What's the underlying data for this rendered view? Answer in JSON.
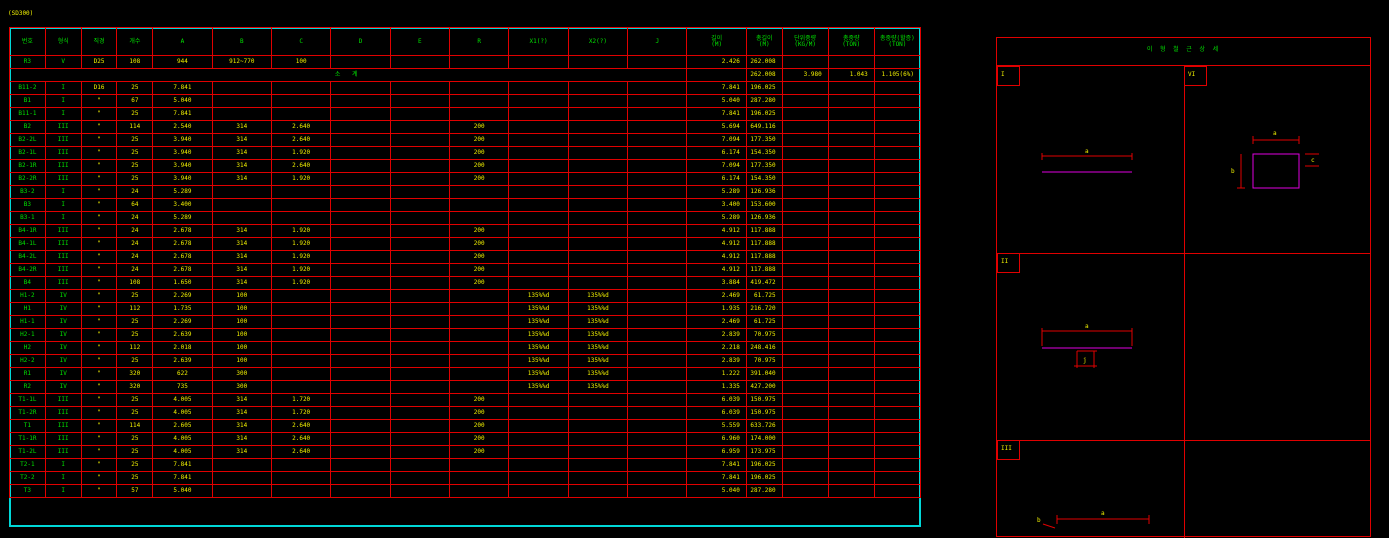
{
  "caption": "(SD300)",
  "table": {
    "headers": [
      "번호",
      "형식",
      "직경",
      "개수",
      "A",
      "B",
      "C",
      "D",
      "E",
      "R",
      "X1(?)",
      "X2(?)",
      "J",
      [
        "길이",
        "(M)"
      ],
      [
        "총길이",
        "(M)"
      ],
      [
        "단위중량",
        "(KG/M)"
      ],
      [
        "총중량",
        "(TON)"
      ],
      [
        "총중량(할증)",
        "(TON)"
      ]
    ],
    "rows": [
      [
        "R3",
        "V",
        "D25",
        "108",
        "944",
        "912~770",
        "100",
        "",
        "",
        "",
        "",
        "",
        "",
        "2.426",
        "262.008",
        "",
        "",
        ""
      ],
      [
        "B11-2",
        "I",
        "D16",
        "25",
        "7.841",
        "",
        "",
        "",
        "",
        "",
        "",
        "",
        "",
        "7.841",
        "196.025",
        "",
        "",
        ""
      ],
      [
        "B1",
        "I",
        "\"",
        "67",
        "5.040",
        "",
        "",
        "",
        "",
        "",
        "",
        "",
        "",
        "5.040",
        "287.280",
        "",
        "",
        ""
      ],
      [
        "B11-1",
        "I",
        "\"",
        "25",
        "7.841",
        "",
        "",
        "",
        "",
        "",
        "",
        "",
        "",
        "7.841",
        "196.025",
        "",
        "",
        ""
      ],
      [
        "B2",
        "III",
        "\"",
        "114",
        "2.540",
        "314",
        "2.640",
        "",
        "",
        "200",
        "",
        "",
        "",
        "5.694",
        "649.116",
        "",
        "",
        ""
      ],
      [
        "B2-2L",
        "III",
        "\"",
        "25",
        "3.940",
        "314",
        "2.640",
        "",
        "",
        "200",
        "",
        "",
        "",
        "7.094",
        "177.350",
        "",
        "",
        ""
      ],
      [
        "B2-1L",
        "III",
        "\"",
        "25",
        "3.940",
        "314",
        "1.920",
        "",
        "",
        "200",
        "",
        "",
        "",
        "6.174",
        "154.350",
        "",
        "",
        ""
      ],
      [
        "B2-1R",
        "III",
        "\"",
        "25",
        "3.940",
        "314",
        "2.640",
        "",
        "",
        "200",
        "",
        "",
        "",
        "7.094",
        "177.350",
        "",
        "",
        ""
      ],
      [
        "B2-2R",
        "III",
        "\"",
        "25",
        "3.940",
        "314",
        "1.920",
        "",
        "",
        "200",
        "",
        "",
        "",
        "6.174",
        "154.350",
        "",
        "",
        ""
      ],
      [
        "B3-2",
        "I",
        "\"",
        "24",
        "5.289",
        "",
        "",
        "",
        "",
        "",
        "",
        "",
        "",
        "5.289",
        "126.936",
        "",
        "",
        ""
      ],
      [
        "B3",
        "I",
        "\"",
        "64",
        "3.400",
        "",
        "",
        "",
        "",
        "",
        "",
        "",
        "",
        "3.400",
        "153.600",
        "",
        "",
        ""
      ],
      [
        "B3-1",
        "I",
        "\"",
        "24",
        "5.289",
        "",
        "",
        "",
        "",
        "",
        "",
        "",
        "",
        "5.289",
        "126.936",
        "",
        "",
        ""
      ],
      [
        "B4-1R",
        "III",
        "\"",
        "24",
        "2.678",
        "314",
        "1.920",
        "",
        "",
        "200",
        "",
        "",
        "",
        "4.912",
        "117.888",
        "",
        "",
        ""
      ],
      [
        "B4-1L",
        "III",
        "\"",
        "24",
        "2.678",
        "314",
        "1.920",
        "",
        "",
        "200",
        "",
        "",
        "",
        "4.912",
        "117.888",
        "",
        "",
        ""
      ],
      [
        "B4-2L",
        "III",
        "\"",
        "24",
        "2.678",
        "314",
        "1.920",
        "",
        "",
        "200",
        "",
        "",
        "",
        "4.912",
        "117.888",
        "",
        "",
        ""
      ],
      [
        "B4-2R",
        "III",
        "\"",
        "24",
        "2.678",
        "314",
        "1.920",
        "",
        "",
        "200",
        "",
        "",
        "",
        "4.912",
        "117.888",
        "",
        "",
        ""
      ],
      [
        "B4",
        "III",
        "\"",
        "108",
        "1.650",
        "314",
        "1.920",
        "",
        "",
        "200",
        "",
        "",
        "",
        "3.884",
        "419.472",
        "",
        "",
        ""
      ],
      [
        "H1-2",
        "IV",
        "\"",
        "25",
        "2.269",
        "100",
        "",
        "",
        "",
        "",
        "135%%d",
        "135%%d",
        "",
        "2.469",
        "61.725",
        "",
        "",
        ""
      ],
      [
        "H1",
        "IV",
        "\"",
        "112",
        "1.735",
        "100",
        "",
        "",
        "",
        "",
        "135%%d",
        "135%%d",
        "",
        "1.935",
        "216.720",
        "",
        "",
        ""
      ],
      [
        "H1-1",
        "IV",
        "\"",
        "25",
        "2.269",
        "100",
        "",
        "",
        "",
        "",
        "135%%d",
        "135%%d",
        "",
        "2.469",
        "61.725",
        "",
        "",
        ""
      ],
      [
        "H2-1",
        "IV",
        "\"",
        "25",
        "2.639",
        "100",
        "",
        "",
        "",
        "",
        "135%%d",
        "135%%d",
        "",
        "2.839",
        "70.975",
        "",
        "",
        ""
      ],
      [
        "H2",
        "IV",
        "\"",
        "112",
        "2.018",
        "100",
        "",
        "",
        "",
        "",
        "135%%d",
        "135%%d",
        "",
        "2.218",
        "248.416",
        "",
        "",
        ""
      ],
      [
        "H2-2",
        "IV",
        "\"",
        "25",
        "2.639",
        "100",
        "",
        "",
        "",
        "",
        "135%%d",
        "135%%d",
        "",
        "2.839",
        "70.975",
        "",
        "",
        ""
      ],
      [
        "R1",
        "IV",
        "\"",
        "320",
        "622",
        "300",
        "",
        "",
        "",
        "",
        "135%%d",
        "135%%d",
        "",
        "1.222",
        "391.040",
        "",
        "",
        ""
      ],
      [
        "R2",
        "IV",
        "\"",
        "320",
        "735",
        "300",
        "",
        "",
        "",
        "",
        "135%%d",
        "135%%d",
        "",
        "1.335",
        "427.200",
        "",
        "",
        ""
      ],
      [
        "T1-1L",
        "III",
        "\"",
        "25",
        "4.005",
        "314",
        "1.720",
        "",
        "",
        "200",
        "",
        "",
        "",
        "6.039",
        "150.975",
        "",
        "",
        ""
      ],
      [
        "T1-2R",
        "III",
        "\"",
        "25",
        "4.005",
        "314",
        "1.720",
        "",
        "",
        "200",
        "",
        "",
        "",
        "6.039",
        "150.975",
        "",
        "",
        ""
      ],
      [
        "T1",
        "III",
        "\"",
        "114",
        "2.605",
        "314",
        "2.640",
        "",
        "",
        "200",
        "",
        "",
        "",
        "5.559",
        "633.726",
        "",
        "",
        ""
      ],
      [
        "T1-1R",
        "III",
        "\"",
        "25",
        "4.005",
        "314",
        "2.640",
        "",
        "",
        "200",
        "",
        "",
        "",
        "6.960",
        "174.000",
        "",
        "",
        ""
      ],
      [
        "T1-2L",
        "III",
        "\"",
        "25",
        "4.005",
        "314",
        "2.640",
        "",
        "",
        "200",
        "",
        "",
        "",
        "6.959",
        "173.975",
        "",
        "",
        ""
      ],
      [
        "T2-1",
        "I",
        "\"",
        "25",
        "7.841",
        "",
        "",
        "",
        "",
        "",
        "",
        "",
        "",
        "7.841",
        "196.025",
        "",
        "",
        ""
      ],
      [
        "T2-2",
        "I",
        "\"",
        "25",
        "7.841",
        "",
        "",
        "",
        "",
        "",
        "",
        "",
        "",
        "7.841",
        "196.025",
        "",
        "",
        ""
      ],
      [
        "T3",
        "I",
        "\"",
        "57",
        "5.040",
        "",
        "",
        "",
        "",
        "",
        "",
        "",
        "",
        "5.040",
        "287.280",
        "",
        "",
        ""
      ]
    ],
    "subtotal": {
      "label": "소 계",
      "total_length": "262.008",
      "unit_weight": "3.980",
      "total_weight": "1.043",
      "with_premium": "1.105(6%)"
    }
  },
  "details": {
    "title": "이 형 철 근 상 세",
    "tags": [
      "I",
      "VI",
      "II",
      "III"
    ],
    "dims": {
      "a": "a",
      "b": "b",
      "c": "c",
      "j": "j"
    }
  },
  "colors": {
    "grid": "#e00000",
    "border": "#00d8d8",
    "text": "#f0f000",
    "header": "#00e000",
    "magenta": "#e000e0"
  }
}
